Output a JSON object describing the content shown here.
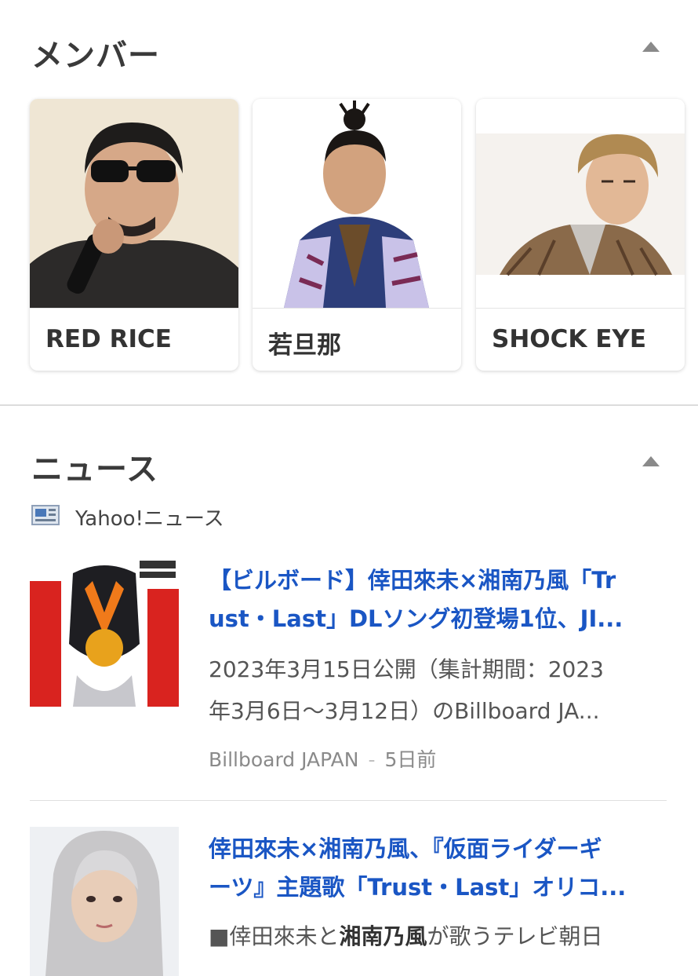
{
  "members_section": {
    "title": "メンバー",
    "cards": [
      {
        "name": "RED RICE"
      },
      {
        "name": "若旦那"
      },
      {
        "name": "SHOCK EYE"
      }
    ]
  },
  "news_section": {
    "title": "ニュース",
    "source": "Yahoo!ニュース",
    "articles": [
      {
        "title_line1": "【ビルボード】倖田來未×湘南乃風「Tr",
        "title_line2": "ust・Last」DLソング初登場1位、JI...",
        "snippet_line1": "2023年3月15日公開（集計期間：2023",
        "snippet_line2": "年3月6日〜3月12日）のBillboard JA...",
        "publisher": "Billboard JAPAN",
        "time": "5日前"
      },
      {
        "title_line1": "倖田來未×湘南乃風、『仮面ライダーギ",
        "title_line2": "ーツ』主題歌「Trust・Last」オリコ...",
        "snippet_prefix": "■倖田來未と",
        "snippet_bold": "湘南乃風",
        "snippet_suffix": "が歌うテレビ朝日"
      }
    ]
  }
}
